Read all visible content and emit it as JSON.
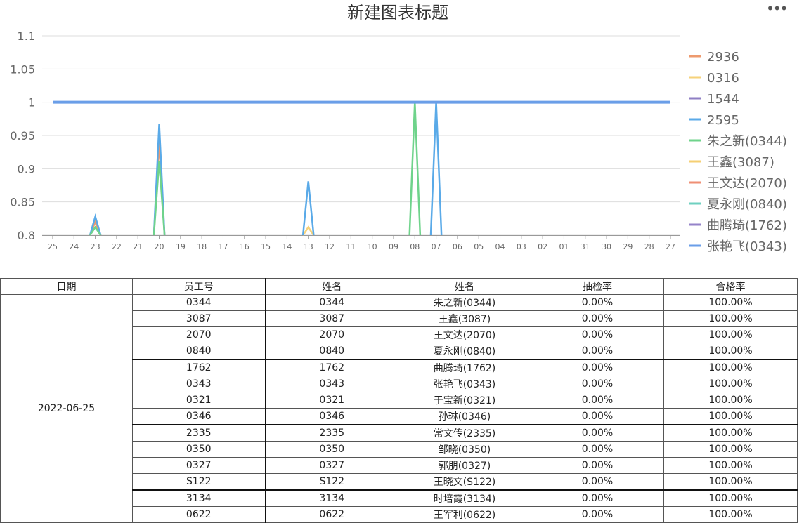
{
  "menu_icon": "more-dots-icon",
  "chart_data": {
    "type": "line",
    "title": "新建图表标题",
    "y_ticks": [
      "1.1",
      "1.05",
      "1",
      "0.95",
      "0.9",
      "0.85",
      "0.8"
    ],
    "ylim": [
      0.8,
      1.1
    ],
    "x_labels": [
      "25",
      "24",
      "23",
      "22",
      "21",
      "20",
      "19",
      "18",
      "17",
      "16",
      "15",
      "14",
      "13",
      "12",
      "11",
      "10",
      "09",
      "08",
      "07",
      "06",
      "05",
      "04",
      "03",
      "02",
      "01",
      "31",
      "30",
      "29",
      "28",
      "27"
    ],
    "grid": true,
    "legend_position": "right",
    "series": [
      {
        "name": "2936",
        "color": "#ee9a6e",
        "values": [
          null,
          null,
          0.82,
          null,
          null,
          0.94,
          null,
          null,
          null,
          null,
          null,
          null,
          null,
          null,
          null,
          null,
          null,
          null,
          null,
          null,
          null,
          null,
          null,
          null,
          null,
          null,
          null,
          null,
          null,
          null
        ]
      },
      {
        "name": "0316",
        "color": "#f6d27a",
        "values": [
          null,
          null,
          null,
          null,
          null,
          null,
          null,
          null,
          null,
          null,
          null,
          null,
          0.812,
          null,
          null,
          null,
          null,
          null,
          null,
          null,
          null,
          null,
          null,
          null,
          null,
          null,
          null,
          null,
          null,
          null
        ]
      },
      {
        "name": "1544",
        "color": "#8f7fc4",
        "values": [
          null,
          null,
          null,
          null,
          null,
          null,
          null,
          null,
          null,
          null,
          null,
          null,
          null,
          null,
          null,
          null,
          null,
          null,
          null,
          null,
          null,
          null,
          null,
          null,
          null,
          null,
          null,
          null,
          null,
          null
        ]
      },
      {
        "name": "2595",
        "color": "#5aaae8",
        "values": [
          null,
          null,
          0.828,
          null,
          null,
          0.967,
          null,
          null,
          null,
          null,
          null,
          null,
          0.881,
          null,
          null,
          null,
          null,
          null,
          1,
          null,
          null,
          null,
          null,
          null,
          null,
          null,
          null,
          null,
          null,
          null
        ]
      },
      {
        "name": "朱之新(0344)",
        "color": "#6fd38b",
        "values": [
          null,
          null,
          0.812,
          null,
          null,
          0.912,
          null,
          null,
          null,
          null,
          null,
          null,
          null,
          null,
          null,
          null,
          null,
          1,
          null,
          null,
          null,
          null,
          null,
          null,
          null,
          null,
          null,
          null,
          null,
          null
        ]
      },
      {
        "name": "王鑫(3087)",
        "color": "#f5cf73",
        "values": [
          null,
          null,
          null,
          null,
          null,
          null,
          null,
          null,
          null,
          null,
          null,
          null,
          null,
          null,
          null,
          null,
          null,
          null,
          null,
          null,
          null,
          null,
          null,
          null,
          null,
          null,
          null,
          null,
          null,
          null
        ]
      },
      {
        "name": "王文达(2070)",
        "color": "#ef8f74",
        "values": [
          null,
          null,
          null,
          null,
          null,
          null,
          null,
          null,
          null,
          null,
          null,
          null,
          null,
          null,
          null,
          null,
          null,
          null,
          null,
          null,
          null,
          null,
          null,
          null,
          null,
          null,
          null,
          null,
          null,
          null
        ]
      },
      {
        "name": "夏永刚(0840)",
        "color": "#6fd0c0",
        "values": [
          null,
          null,
          null,
          null,
          null,
          null,
          null,
          null,
          null,
          null,
          null,
          null,
          null,
          null,
          null,
          null,
          null,
          null,
          null,
          null,
          null,
          null,
          null,
          null,
          null,
          null,
          null,
          null,
          null,
          null
        ]
      },
      {
        "name": "曲腾琦(1762)",
        "color": "#9583c9",
        "values": [
          null,
          null,
          null,
          null,
          null,
          null,
          null,
          null,
          null,
          null,
          null,
          null,
          null,
          null,
          null,
          null,
          null,
          null,
          null,
          null,
          null,
          null,
          null,
          null,
          null,
          null,
          null,
          null,
          null,
          null
        ]
      },
      {
        "name": "张艳飞(0343)",
        "color": "#6a9ee8",
        "values": [
          1,
          1,
          1,
          1,
          1,
          1,
          1,
          1,
          1,
          1,
          1,
          1,
          1,
          1,
          1,
          1,
          1,
          1,
          1,
          1,
          1,
          1,
          1,
          1,
          1,
          1,
          1,
          1,
          1,
          1
        ]
      }
    ]
  },
  "table": {
    "headers": [
      "日期",
      "员工号",
      "姓名",
      "姓名",
      "抽检率",
      "合格率"
    ],
    "date": "2022-06-25",
    "rows": [
      [
        "0344",
        "0344",
        "朱之新(0344)",
        "0.00%",
        "100.00%"
      ],
      [
        "3087",
        "3087",
        "王鑫(3087)",
        "0.00%",
        "100.00%"
      ],
      [
        "2070",
        "2070",
        "王文达(2070)",
        "0.00%",
        "100.00%"
      ],
      [
        "0840",
        "0840",
        "夏永刚(0840)",
        "0.00%",
        "100.00%"
      ],
      [
        "1762",
        "1762",
        "曲腾琦(1762)",
        "0.00%",
        "100.00%"
      ],
      [
        "0343",
        "0343",
        "张艳飞(0343)",
        "0.00%",
        "100.00%"
      ],
      [
        "0321",
        "0321",
        "于宝新(0321)",
        "0.00%",
        "100.00%"
      ],
      [
        "0346",
        "0346",
        "孙琳(0346)",
        "0.00%",
        "100.00%"
      ],
      [
        "2335",
        "2335",
        "常文传(2335)",
        "0.00%",
        "100.00%"
      ],
      [
        "0350",
        "0350",
        "邹晓(0350)",
        "0.00%",
        "100.00%"
      ],
      [
        "0327",
        "0327",
        "郭朋(0327)",
        "0.00%",
        "100.00%"
      ],
      [
        "S122",
        "S122",
        "王晓文(S122)",
        "0.00%",
        "100.00%"
      ],
      [
        "3134",
        "3134",
        "时培霞(3134)",
        "0.00%",
        "100.00%"
      ],
      [
        "0622",
        "0622",
        "王军利(0622)",
        "0.00%",
        "100.00%"
      ]
    ]
  }
}
